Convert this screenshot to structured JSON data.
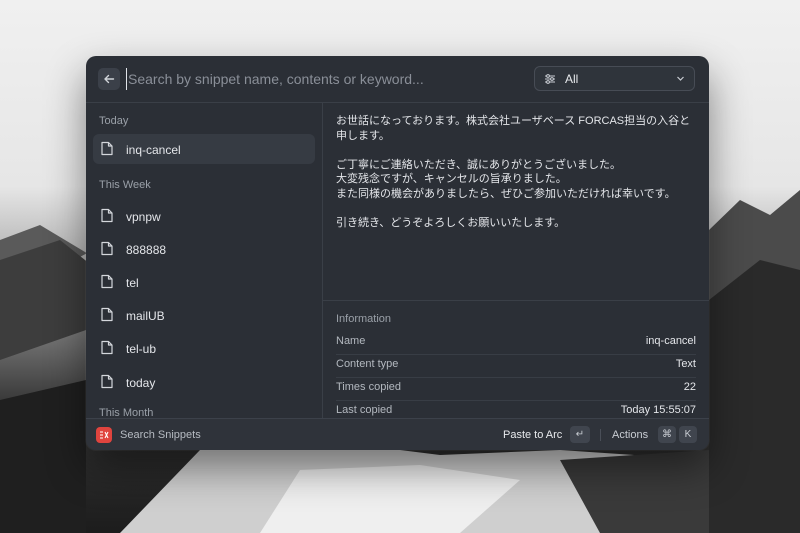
{
  "search": {
    "placeholder": "Search by snippet name, contents or keyword..."
  },
  "filter": {
    "label": "All"
  },
  "sections": [
    {
      "label": "Today",
      "items": [
        {
          "label": "inq-cancel",
          "selected": true
        }
      ]
    },
    {
      "label": "This Week",
      "items": [
        {
          "label": "vpnpw"
        },
        {
          "label": "888888"
        },
        {
          "label": "tel"
        },
        {
          "label": "mailUB"
        },
        {
          "label": "tel-ub"
        },
        {
          "label": "today"
        }
      ]
    },
    {
      "label": "This Month",
      "items": []
    }
  ],
  "preview": {
    "text": "お世話になっております。株式会社ユーザベース FORCAS担当の入谷と\n申します。\n\nご丁寧にご連絡いただき、誠にありがとうございました。\n大変残念ですが、キャンセルの旨承りました。\nまた同様の機会がありましたら、ぜひご参加いただければ幸いです。\n\n引き続き、どうぞよろしくお願いいたします。"
  },
  "information": {
    "title": "Information",
    "rows": [
      {
        "key": "Name",
        "value": "inq-cancel"
      },
      {
        "key": "Content type",
        "value": "Text"
      },
      {
        "key": "Times copied",
        "value": "22"
      },
      {
        "key": "Last copied",
        "value": "Today 15:55:07"
      }
    ]
  },
  "footer": {
    "title": "Search Snippets",
    "primary_action": "Paste to Arc",
    "primary_key": "↵",
    "actions_label": "Actions",
    "actions_keys": [
      "⌘",
      "K"
    ]
  },
  "colors": {
    "window_bg": "#2b2f36",
    "app_icon": "#e0443e",
    "selected_item": "#363b43"
  }
}
